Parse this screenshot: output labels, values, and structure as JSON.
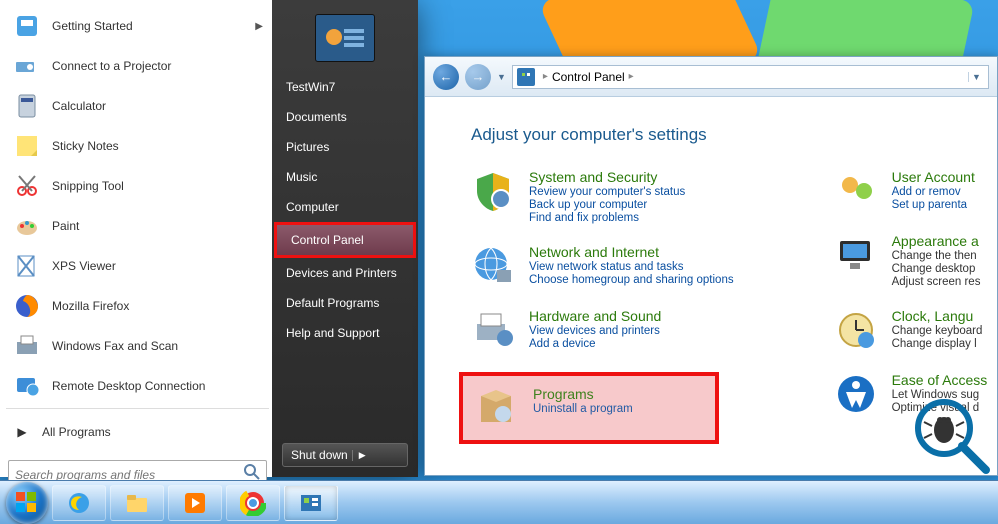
{
  "start_menu": {
    "left_items": [
      {
        "label": "Getting Started",
        "icon": "flag",
        "arrow": true
      },
      {
        "label": "Connect to a Projector",
        "icon": "projector"
      },
      {
        "label": "Calculator",
        "icon": "calc"
      },
      {
        "label": "Sticky Notes",
        "icon": "sticky"
      },
      {
        "label": "Snipping Tool",
        "icon": "snip"
      },
      {
        "label": "Paint",
        "icon": "paint"
      },
      {
        "label": "XPS Viewer",
        "icon": "xps"
      },
      {
        "label": "Mozilla Firefox",
        "icon": "firefox"
      },
      {
        "label": "Windows Fax and Scan",
        "icon": "fax"
      },
      {
        "label": "Remote Desktop Connection",
        "icon": "rdp"
      }
    ],
    "all_programs": "All Programs",
    "search_placeholder": "Search programs and files",
    "right_top_user": "TestWin7",
    "right_items": [
      "Documents",
      "Pictures",
      "Music",
      "Computer",
      "Control Panel",
      "Devices and Printers",
      "Default Programs",
      "Help and Support"
    ],
    "highlight_index": 4,
    "shutdown": "Shut down"
  },
  "control_panel": {
    "breadcrumb": [
      "Control Panel"
    ],
    "heading": "Adjust your computer's settings",
    "col1": [
      {
        "title": "System and Security",
        "links": [
          "Review your computer's status",
          "Back up your computer",
          "Find and fix problems"
        ],
        "icon": "shield"
      },
      {
        "title": "Network and Internet",
        "links": [
          "View network status and tasks",
          "Choose homegroup and sharing options"
        ],
        "icon": "globe"
      },
      {
        "title": "Hardware and Sound",
        "links": [
          "View devices and printers",
          "Add a device"
        ],
        "icon": "printer"
      },
      {
        "title": "Programs",
        "links": [
          "Uninstall a program"
        ],
        "icon": "box",
        "highlight": true
      }
    ],
    "col2": [
      {
        "title": "User Account",
        "links": [
          "Add or remov",
          "Set up parenta"
        ],
        "icon": "users"
      },
      {
        "title": "Appearance a",
        "links": [
          "Change the then",
          "Change desktop",
          "Adjust screen res"
        ],
        "icon": "monitor",
        "dark": true
      },
      {
        "title": "Clock, Langu",
        "links": [
          "Change keyboard",
          "Change display l"
        ],
        "icon": "clock",
        "dark": true
      },
      {
        "title": "Ease of Access",
        "links": [
          "Let Windows sug",
          "Optimize visual d"
        ],
        "icon": "ease",
        "dark": true
      }
    ]
  },
  "taskbar": {
    "items": [
      "ie",
      "folder",
      "media",
      "chrome",
      "cp"
    ],
    "active_index": 4
  }
}
